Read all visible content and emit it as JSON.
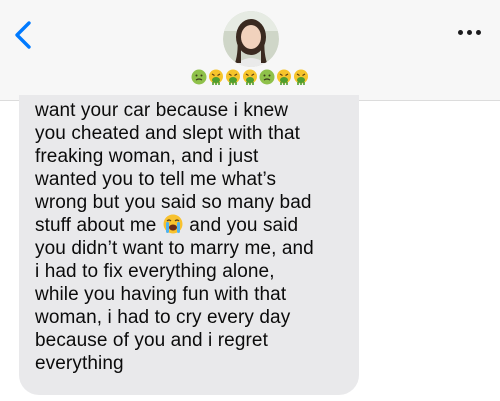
{
  "header": {
    "back_icon": "chevron-left-icon",
    "more_icon": "ellipsis-icon",
    "avatar_icon": "contact-photo",
    "name_emojis": [
      "nauseated-face",
      "face-vomiting",
      "face-vomiting",
      "face-vomiting",
      "nauseated-face",
      "face-vomiting",
      "face-vomiting"
    ],
    "accent": "#007aff"
  },
  "message": {
    "lines": [
      "want your car because i knew",
      "you cheated and slept with that",
      "freaking woman, and i just",
      "wanted you to tell me what’s",
      "wrong but you said so many bad",
      "stuff about me",
      "and you said",
      "you didn’t want to marry me, and",
      "i had to fix everything alone,",
      "while you having fun with that",
      "woman, i had to cry every day",
      "because of you and i regret",
      "everything"
    ],
    "inline_emoji": "loudly-crying-face",
    "bubble_color": "#e9e9eb"
  }
}
